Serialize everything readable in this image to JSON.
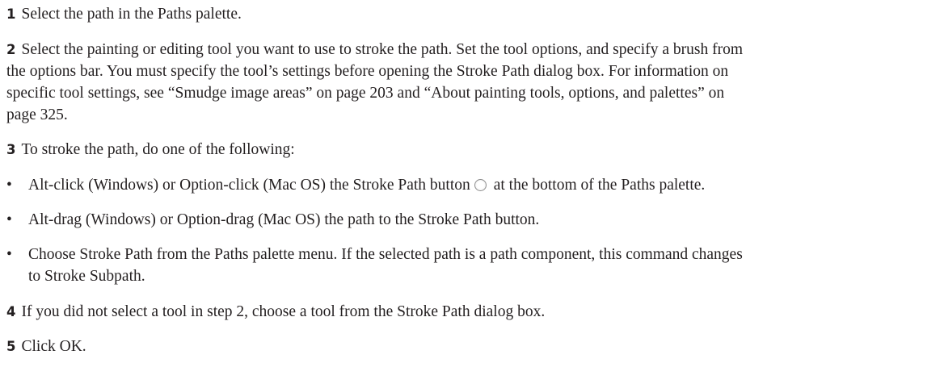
{
  "steps": {
    "s1": {
      "num": "1",
      "text": "Select the path in the Paths palette."
    },
    "s2": {
      "num": "2",
      "line1": "Select the painting or editing tool you want to use to stroke the path. Set the tool options, and specify a brush from",
      "line2": "the options bar. You must specify the tool’s settings before opening the Stroke Path dialog box. For information on",
      "line3": "specific tool settings, see “Smudge image areas” on page 203 and “About painting tools, options, and palettes” on",
      "line4": "page 325."
    },
    "s3": {
      "num": "3",
      "text": "To stroke the path, do one of the following:",
      "bullet_symbol": "•",
      "b1_before": "Alt-click (Windows) or Option-click (Mac OS) the Stroke Path button",
      "b1_icon": "stroke-path-icon",
      "b1_after": "at the bottom of the Paths palette.",
      "b2": "Alt-drag (Windows) or Option-drag (Mac OS) the path to the Stroke Path button.",
      "b3_line1": "Choose Stroke Path from the Paths palette menu. If the selected path is a path component, this command changes",
      "b3_line2": "to Stroke Subpath."
    },
    "s4": {
      "num": "4",
      "text": "If you did not select a tool in step 2, choose a tool from the Stroke Path dialog box."
    },
    "s5": {
      "num": "5",
      "text": "Click OK."
    }
  }
}
